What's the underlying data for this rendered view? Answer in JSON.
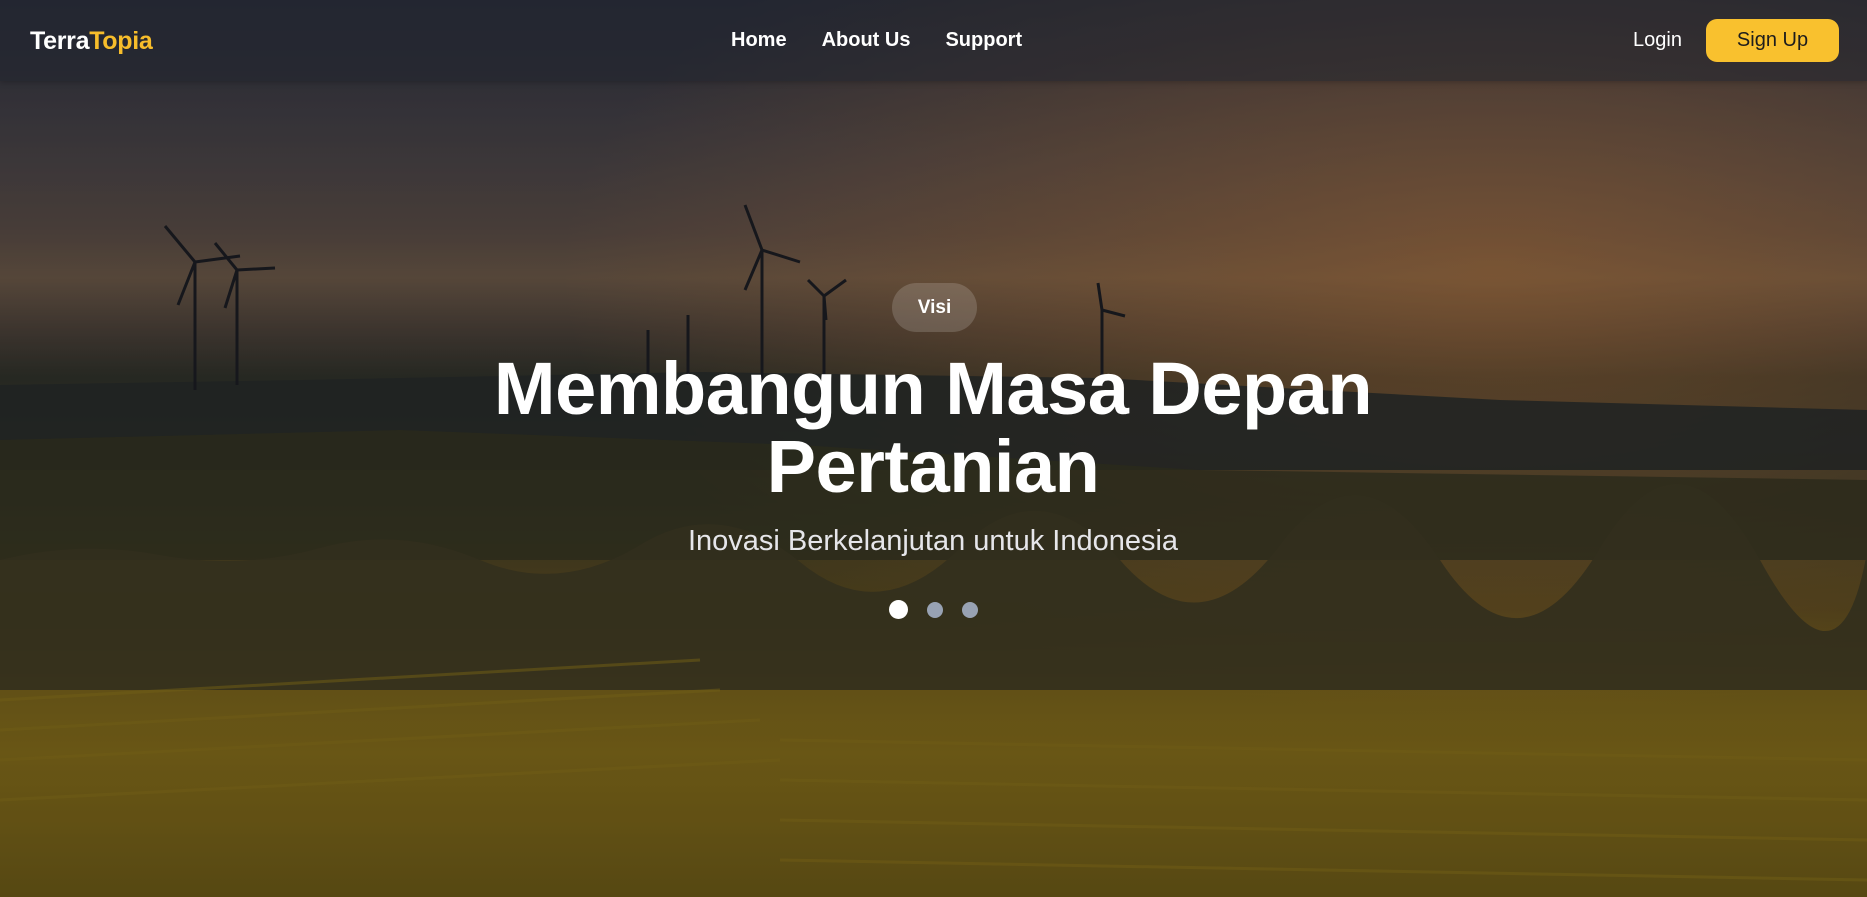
{
  "navbar": {
    "logo_part1": "Terra",
    "logo_part2": "Topia",
    "links": [
      {
        "label": "Home"
      },
      {
        "label": "About Us"
      },
      {
        "label": "Support"
      }
    ],
    "login_label": "Login",
    "signup_label": "Sign Up"
  },
  "hero": {
    "badge": "Visi",
    "title": "Membangun Masa Depan Pertanian",
    "subtitle": "Inovasi Berkelanjutan untuk Indonesia",
    "slides_total": 3,
    "active_slide": 1
  },
  "colors": {
    "accent": "#f9c12e",
    "logo_accent": "#f7bd2b",
    "dot_inactive": "#98a2b3",
    "dot_active": "#ffffff"
  }
}
